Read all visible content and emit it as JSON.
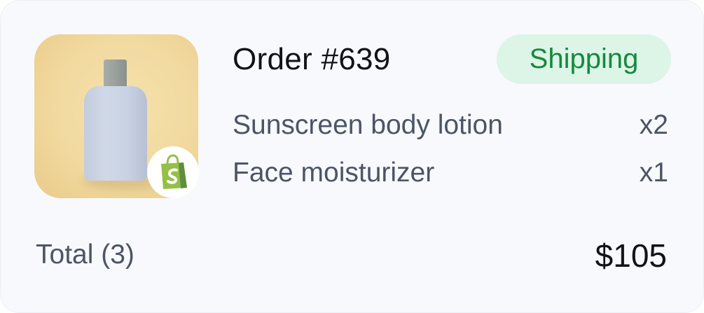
{
  "order": {
    "title": "Order #639",
    "status": "Shipping",
    "status_color": "#16893f",
    "status_bg": "#dcf5e6",
    "product_image": "sunscreen-bottle",
    "store_icon": "shopify-bag-icon",
    "items": [
      {
        "name": "Sunscreen body lotion",
        "qty": "x2"
      },
      {
        "name": "Face moisturizer",
        "qty": "x1"
      }
    ],
    "total_label": "Total (3)",
    "total_amount": "$105"
  }
}
